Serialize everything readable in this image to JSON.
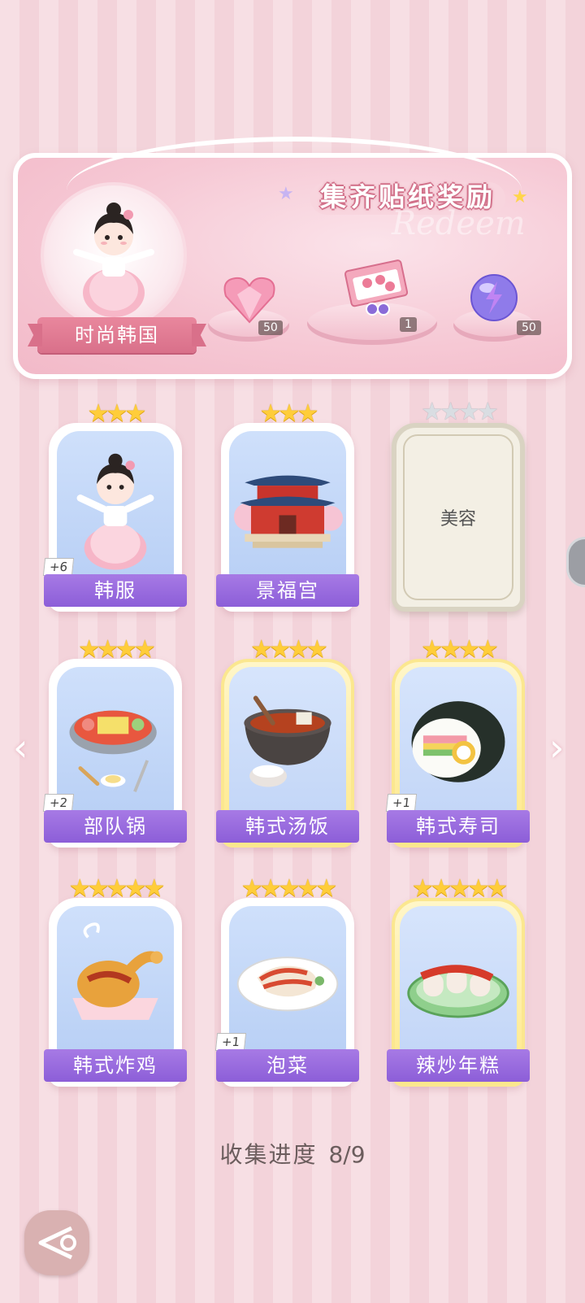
{
  "banner": {
    "title": "集齐贴纸奖励",
    "watermark": "Redeem",
    "theme_name": "时尚韩国",
    "rewards": [
      {
        "icon": "pink-heart-gem-icon",
        "count": "50"
      },
      {
        "icon": "gift-box-bundle-icon",
        "count": "1"
      },
      {
        "icon": "purple-lightning-orb-icon",
        "count": "50"
      }
    ]
  },
  "cards": [
    {
      "label": "韩服",
      "stars": 3,
      "max_stars": 3,
      "bonus": "+6",
      "frame": "blue",
      "icon": "hanbok-girl-icon"
    },
    {
      "label": "景福宫",
      "stars": 3,
      "max_stars": 3,
      "bonus": "",
      "frame": "blue",
      "icon": "gyeongbokgung-palace-icon"
    },
    {
      "label": "美容",
      "stars": 0,
      "max_stars": 4,
      "bonus": "",
      "frame": "locked",
      "icon": ""
    },
    {
      "label": "部队锅",
      "stars": 4,
      "max_stars": 4,
      "bonus": "+2",
      "frame": "blue",
      "icon": "army-stew-icon"
    },
    {
      "label": "韩式汤饭",
      "stars": 4,
      "max_stars": 4,
      "bonus": "",
      "frame": "gold",
      "icon": "soup-rice-icon"
    },
    {
      "label": "韩式寿司",
      "stars": 4,
      "max_stars": 4,
      "bonus": "+1",
      "frame": "gold",
      "icon": "kimbap-icon"
    },
    {
      "label": "韩式炸鸡",
      "stars": 5,
      "max_stars": 5,
      "bonus": "",
      "frame": "blue",
      "icon": "fried-chicken-icon"
    },
    {
      "label": "泡菜",
      "stars": 5,
      "max_stars": 5,
      "bonus": "+1",
      "frame": "blue",
      "icon": "kimchi-icon"
    },
    {
      "label": "辣炒年糕",
      "stars": 5,
      "max_stars": 5,
      "bonus": "",
      "frame": "gold",
      "icon": "tteokbokki-icon"
    }
  ],
  "progress": {
    "label": "收集进度",
    "value": "8/9"
  },
  "nav": {
    "prev": "‹",
    "next": "›"
  },
  "colors": {
    "label_purple": "#9466dc",
    "star_gold": "#ffcd3a",
    "banner_pink": "#f6c9d5"
  }
}
